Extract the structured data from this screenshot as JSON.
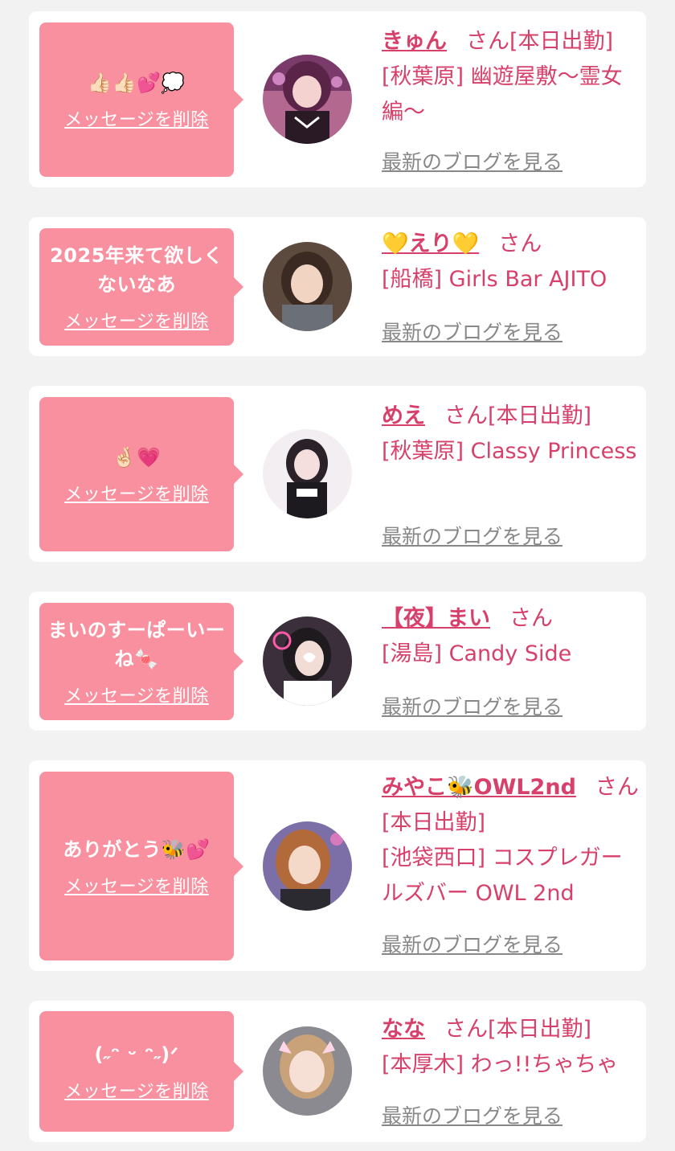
{
  "delete_label": "メッセージを削除",
  "blog_label": "最新のブログを見る",
  "honorific": "さん",
  "colors": {
    "accent": "#d7406a",
    "bubble": "#f9909f",
    "card": "#ffffff",
    "background": "#f2f2f2",
    "link_gray": "#888888"
  },
  "items": [
    {
      "message": "👍🏻👍🏻💕💭",
      "name": "きゅん",
      "attendance": "[本日出勤]",
      "shop": "[秋葉原] 幽遊屋敷〜霊女編〜"
    },
    {
      "message": "2025年来て欲しくないなあ",
      "name": "💛えり💛",
      "attendance": "",
      "shop": "[船橋] Girls Bar AJITO"
    },
    {
      "message": "🤞🏻💗",
      "name": "めえ",
      "attendance": "[本日出勤]",
      "shop": "[秋葉原] Classy Princess"
    },
    {
      "message": "まいのすーぱーいーね🍬",
      "name": "【夜】まい",
      "attendance": "",
      "shop": "[湯島] Candy Side"
    },
    {
      "message": "ありがとう🐝💕",
      "name": "みやこ🐝OWL2nd",
      "attendance": "[本日出勤]",
      "shop": "[池袋西口] コスプレガールズバー OWL 2nd"
    },
    {
      "message": "(˶ᵔ ᵕ ᵔ˶)ᐟ",
      "name": "なな",
      "attendance": "[本日出勤]",
      "shop": "[本厚木] わっ!!ちゃちゃ"
    }
  ]
}
